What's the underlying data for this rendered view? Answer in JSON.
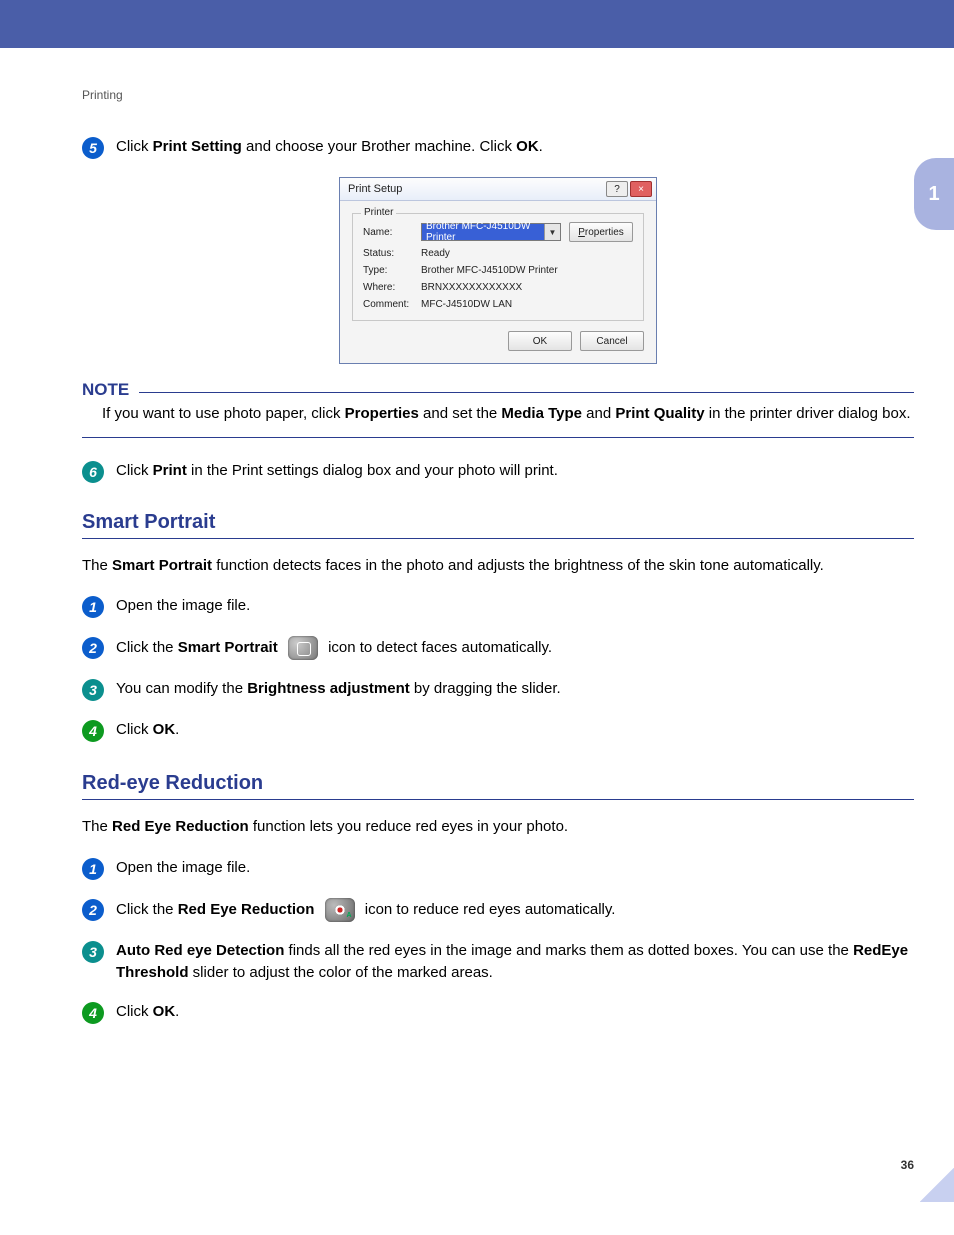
{
  "header": "Printing",
  "sidetab": "1",
  "step5": {
    "pre": "Click ",
    "b1": "Print Setting",
    "mid": " and choose your Brother machine. Click ",
    "b2": "OK",
    "post": "."
  },
  "dialog": {
    "title": "Print Setup",
    "help": "?",
    "close": "×",
    "group": "Printer",
    "name_lbl": "Name:",
    "name_val": "Brother MFC-J4510DW Printer",
    "props_btn_u": "P",
    "props_btn_rest": "roperties",
    "status_lbl": "Status:",
    "status_val": "Ready",
    "type_lbl": "Type:",
    "type_val": "Brother MFC-J4510DW Printer",
    "where_lbl": "Where:",
    "where_val": "BRNXXXXXXXXXXXX",
    "comment_lbl": "Comment:",
    "comment_val": "MFC-J4510DW LAN",
    "ok": "OK",
    "cancel": "Cancel"
  },
  "note": {
    "title": "NOTE",
    "pre": "If you want to use photo paper, click ",
    "b1": "Properties",
    "mid1": " and set the ",
    "b2": "Media Type",
    "mid2": " and ",
    "b3": "Print Quality",
    "post": " in the printer driver dialog box."
  },
  "step6": {
    "pre": "Click ",
    "b1": "Print",
    "post": " in the Print settings dialog box and your photo will print."
  },
  "sec1": {
    "title": "Smart Portrait",
    "intro_pre": "The ",
    "intro_b": "Smart Portrait",
    "intro_post": " function detects faces in the photo and adjusts the brightness of the skin tone automatically.",
    "s1": "Open the image file.",
    "s2_pre": "Click the ",
    "s2_b": "Smart Portrait",
    "s2_post": " icon to detect faces automatically.",
    "s3_pre": "You can modify the ",
    "s3_b": "Brightness adjustment",
    "s3_post": " by dragging the slider.",
    "s4_pre": "Click ",
    "s4_b": "OK",
    "s4_post": "."
  },
  "sec2": {
    "title": "Red-eye Reduction",
    "intro_pre": "The ",
    "intro_b": "Red Eye Reduction",
    "intro_post": " function lets you reduce red eyes in your photo.",
    "s1": "Open the image file.",
    "s2_pre": "Click the ",
    "s2_b": "Red Eye Reduction",
    "s2_post": " icon to reduce red eyes automatically.",
    "s3_b1": "Auto Red eye Detection",
    "s3_mid": " finds all the red eyes in the image and marks them as dotted boxes. You can use the ",
    "s3_b2": "RedEye Threshold",
    "s3_post": " slider to adjust the color of the marked areas.",
    "s4_pre": "Click ",
    "s4_b": "OK",
    "s4_post": "."
  },
  "pagenum": "36"
}
